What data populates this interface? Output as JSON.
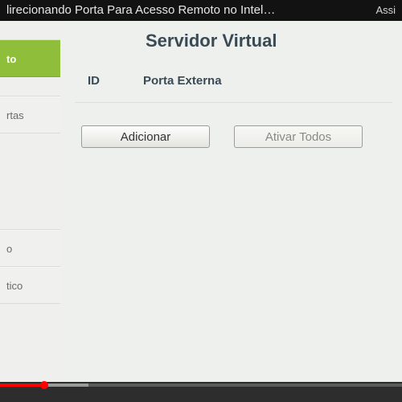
{
  "topbar": {
    "title_fragment": "lirecionando Porta Para Acesso Remoto no Intel…",
    "right_text": "Assi"
  },
  "sidebar": {
    "items": [
      {
        "label": "to",
        "active": true
      },
      {
        "label": "rtas",
        "active": false
      },
      {
        "label": "o",
        "active": false
      },
      {
        "label": "tico",
        "active": false
      }
    ]
  },
  "content": {
    "title": "Servidor Virtual",
    "columns": [
      "ID",
      "Porta Externa"
    ],
    "buttons": {
      "add": "Adicionar",
      "enable_all": "Ativar Todos"
    }
  },
  "player": {
    "played_pct": 11,
    "buffered_pct": 22
  }
}
